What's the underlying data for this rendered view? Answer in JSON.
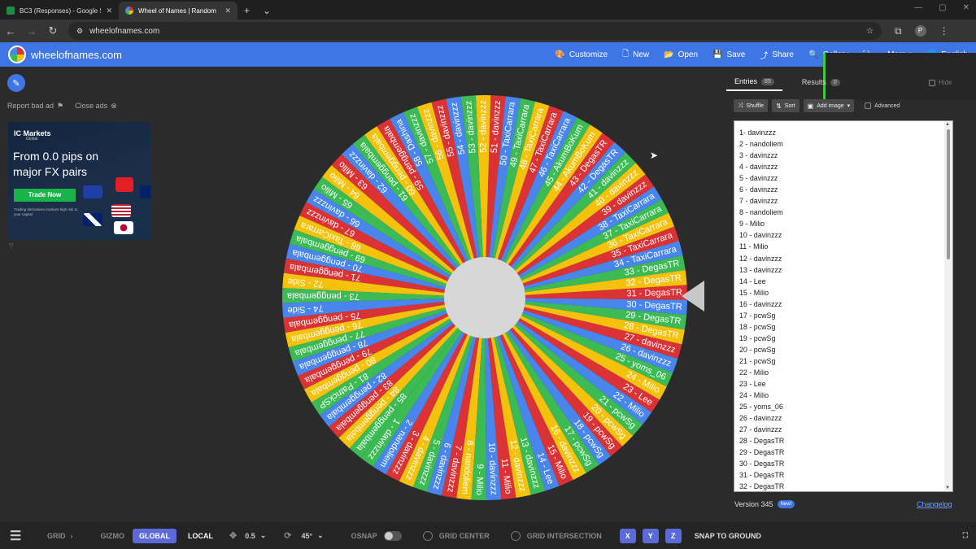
{
  "browser": {
    "tabs": [
      {
        "title": "BC3 (Responses) - Google S",
        "color": "#1e8e3e",
        "active": false
      },
      {
        "title": "Wheel of Names | Random",
        "color": "#f4c20d",
        "active": true
      }
    ],
    "new_tab": "+",
    "tab_menu": "⌄",
    "url": "wheelofnames.com",
    "avatar": "P"
  },
  "app": {
    "brand": "wheelofnames.com",
    "menu": [
      {
        "icon": "palette-icon",
        "glyph": "🎨",
        "label": "Customize"
      },
      {
        "icon": "new-file-icon",
        "glyph": "🗋",
        "label": "New"
      },
      {
        "icon": "folder-open-icon",
        "glyph": "📂",
        "label": "Open"
      },
      {
        "icon": "save-icon",
        "glyph": "💾",
        "label": "Save"
      },
      {
        "icon": "share-icon",
        "glyph": "⤴",
        "label": "Share"
      },
      {
        "icon": "search-icon",
        "glyph": "🔍",
        "label": "Gallery"
      },
      {
        "icon": "fullscreen-icon",
        "glyph": "⛶",
        "label": ""
      },
      {
        "icon": "more-icon",
        "glyph": "",
        "label": "More ▾"
      },
      {
        "icon": "globe-icon",
        "glyph": "🌐",
        "label": "English"
      }
    ]
  },
  "ad": {
    "report": "Report bad ad",
    "close": "Close ads",
    "brand": "IC Markets",
    "brand_sub": "Global",
    "headline": "From 0.0 pips on major FX pairs",
    "cta": "Trade Now",
    "disclaimer": "Trading derivatives involves high risk to your capital"
  },
  "colors": {
    "segments": [
      "#3cba54",
      "#4885ed",
      "#db3236",
      "#f4c20d"
    ],
    "accent": "#3f76e6"
  },
  "panel": {
    "tab_entries": "Entries",
    "entries_count": "85",
    "tab_results": "Results",
    "results_count": "0",
    "hide": "Hide",
    "shuffle": "Shuffle",
    "sort": "Sort",
    "add_image": "Add image",
    "advanced": "Advanced",
    "version": "Version 345",
    "new_badge": "New!",
    "changelog": "Changelog"
  },
  "entries": [
    "1- davinzzz",
    "2 - nandoliem",
    "3 - davinzzz",
    "4 - davinzzz",
    "5 - davinzzz",
    "6 - davinzzz",
    "7 - davinzzz",
    "8 - nandoliem",
    "9 - Milio",
    "10 - davinzzz",
    "11 - Milio",
    "12 - davinzzz",
    "13 - davinzzz",
    "14 - Lee",
    "15 - Milio",
    "16 - davinzzz",
    "17 - pcwSg",
    "18 - pcwSg",
    "19 - pcwSg",
    "20 - pcwSg",
    "21 - pcwSg",
    "22 - Milio",
    "23 - Lee",
    "24 - Milio",
    "25 - yoms_06",
    "26 - davinzzz",
    "27 - davinzzz",
    "28 - DegasTR",
    "29 - DegasTR",
    "30 - DegasTR",
    "31 - DegasTR",
    "32 - DegasTR"
  ],
  "wheel_labels": [
    "1 - davinzzz",
    "2 - nandoliem",
    "3 - davinzzz",
    "4 - davinzzz",
    "5 - davinzzz",
    "6 - davinzzz",
    "7 - davinzzz",
    "8 - nandoliem",
    "9 - Milio",
    "10 - davinzzz",
    "11 - Milio",
    "12 - davinzzz",
    "13 - davinzzz",
    "14 - Lee",
    "15 - Milio",
    "16 - davinzzz",
    "17 - pcwSg",
    "18 - pcwSg",
    "19 - pcwSg",
    "20 - pcwSg",
    "21 - pcwSg",
    "22 - Milio",
    "23 - Lee",
    "24 - Milio",
    "25 - yoms_06",
    "26 - davinzzz",
    "27 - davinzzz",
    "28 - DegasTR",
    "29 - DegasTR",
    "30 - DegasTR",
    "31 - DegasTR",
    "32 - DegasTR",
    "33 - DegasTR",
    "34 - TaxiCarrara",
    "35 - TaxiCarrara",
    "36 - TaxiCarrara",
    "37 - TaxiCarrara",
    "38 - TaxiCarrara",
    "39 - davinzzz",
    "40 - davinzzz",
    "41 - davinzzz",
    "42 - DegasTR",
    "43 - DegasTR",
    "44 - AkumBoKum",
    "45 - AkumBoKum",
    "46 - TaxiCarrara",
    "47 - TaxiCarrara",
    "48 - TaxiCarrara",
    "49 - TaxiCarrara",
    "50 - TaxiCarrara",
    "51 - davinzzz",
    "52 - davinzzz",
    "53 - davinzzz",
    "54 - davinzzz",
    "55 - davinzzz",
    "56 - davinzzz",
    "57 - davinzzz",
    "58 - Dashina",
    "59 - penggembala",
    "60 - penggembala",
    "61 - penggembala",
    "62 - davinzzz",
    "63 - Milio",
    "64 - Milio",
    "65 - Milio",
    "66 - davinzzz",
    "67 - davinzzz",
    "68 - TaxiCarrara",
    "69 - penggembala",
    "70 - penggembala",
    "71 - penggembala",
    "72 - Side",
    "73 - penggembala",
    "74 - Side",
    "75 - penggembala",
    "76 - penggembala",
    "77 - penggembala",
    "78 - penggembala",
    "79 - penggembala",
    "80 - penggembala",
    "81 - PatrickSP",
    "82 - penggembala",
    "83 - penggembala",
    "84 - penggembala",
    "85 - penggembala"
  ],
  "bottombar": {
    "grid": "GRID",
    "gizmo": "GIZMO",
    "global": "GLOBAL",
    "local": "LOCAL",
    "step": "0.5",
    "angle": "45°",
    "osnap": "OSNAP",
    "grid_center": "GRID CENTER",
    "grid_intersection": "GRID INTERSECTION",
    "x": "X",
    "y": "Y",
    "z": "Z",
    "snap": "SNAP TO GROUND"
  }
}
